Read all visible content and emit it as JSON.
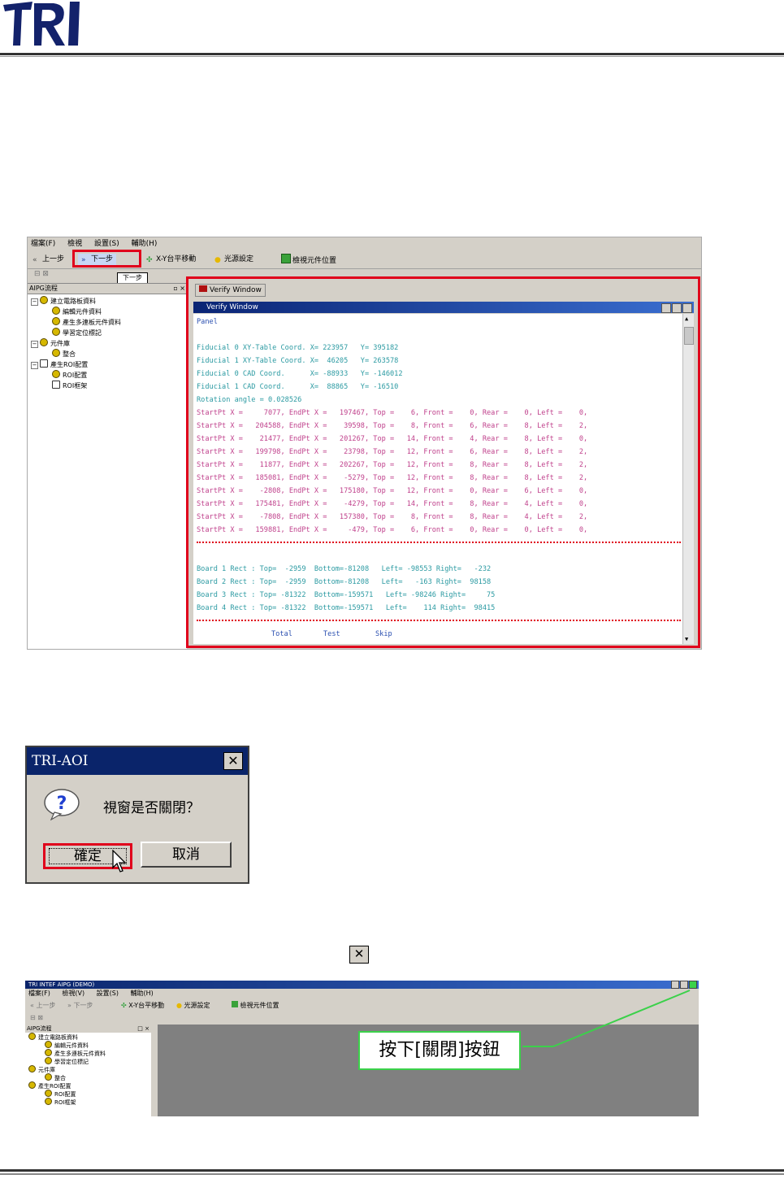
{
  "header": {
    "logo_text": "TRI"
  },
  "screenshot1": {
    "menu": [
      "檔案(F)",
      "檢視",
      "設置(S)",
      "輔助(H)"
    ],
    "toolbar": {
      "prev": "上一步",
      "next": "下一步",
      "xy_move": "X-Y台平移動",
      "light": "光源設定",
      "locate": "檢視元件位置"
    },
    "tooltip": "下一步",
    "tree": {
      "title": "AIPG流程",
      "close": "×",
      "items": [
        {
          "label": "建立電路板資料",
          "level": 0,
          "icon": "node"
        },
        {
          "label": "編輯元件資料",
          "level": 1,
          "icon": "node"
        },
        {
          "label": "產生多連板元件資料",
          "level": 1,
          "icon": "node"
        },
        {
          "label": "學習定位標記",
          "level": 1,
          "icon": "node"
        },
        {
          "label": "元件庫",
          "level": 0,
          "icon": "node"
        },
        {
          "label": "整合",
          "level": 1,
          "icon": "node"
        },
        {
          "label": "產生ROI配置",
          "level": 0,
          "icon": "empty"
        },
        {
          "label": "ROI配置",
          "level": 1,
          "icon": "node"
        },
        {
          "label": "ROI框架",
          "level": 1,
          "icon": "empty"
        }
      ]
    },
    "verify": {
      "tab": "Verify Window",
      "title": "Verify Window",
      "panel": "Panel",
      "fiducial_lines": [
        "Fiducial 0 XY-Table Coord. X= 223957   Y= 395182",
        "Fiducial 1 XY-Table Coord. X=  46205   Y= 263578",
        "Fiducial 0 CAD Coord.      X= -88933   Y= -146012",
        "Fiducial 1 CAD Coord.      X=  88865   Y= -16510",
        "Rotation angle = 0.028526"
      ],
      "start_lines": [
        "StartPt X =     7077, EndPt X =   197467, Top =    6, Front =    0, Rear =    0, Left =    0,",
        "StartPt X =   204588, EndPt X =    39598, Top =    8, Front =    6, Rear =    8, Left =    2,",
        "StartPt X =    21477, EndPt X =   201267, Top =   14, Front =    4, Rear =    8, Left =    0,",
        "StartPt X =   199798, EndPt X =    23798, Top =   12, Front =    6, Rear =    8, Left =    2,",
        "StartPt X =    11877, EndPt X =   202267, Top =   12, Front =    8, Rear =    8, Left =    2,",
        "StartPt X =   185081, EndPt X =    -5279, Top =   12, Front =    8, Rear =    8, Left =    2,",
        "StartPt X =    -2808, EndPt X =   175180, Top =   12, Front =    0, Rear =    6, Left =    0,",
        "StartPt X =   175481, EndPt X =    -4279, Top =   14, Front =    8, Rear =    4, Left =    0,",
        "StartPt X =    -7808, EndPt X =   157380, Top =    8, Front =    8, Rear =    4, Left =    2,",
        "StartPt X =   159881, EndPt X =     -479, Top =    6, Front =    0, Rear =    0, Left =    0,"
      ],
      "board_lines": [
        "Board 1 Rect : Top=  -2959  Bottom=-81208   Left= -98553 Right=   -232",
        "Board 2 Rect : Top=  -2959  Bottom=-81208   Left=   -163 Right=  98158",
        "Board 3 Rect : Top= -81322  Bottom=-159571   Left= -98246 Right=     75",
        "Board 4 Rect : Top= -81322  Bottom=-159571   Left=    114 Right=  98415"
      ],
      "totals": {
        "total": "Total",
        "test": "Test",
        "skip": "Skip"
      }
    }
  },
  "dialog": {
    "title": "TRI-AOI",
    "close": "✕",
    "message": "視窗是否關閉？",
    "ok": "確定",
    "cancel": "取消"
  },
  "close_glyph": "✕",
  "screenshot3": {
    "title": "TRI INTEF AIPG (DEMO)",
    "menu": [
      "檔案(F)",
      "檢視(V)",
      "設置(S)",
      "輔助(H)"
    ],
    "toolbar": {
      "prev": "上一步",
      "next": "下一步",
      "xy_move": "X-Y台平移動",
      "light": "光源設定",
      "locate": "檢視元件位置"
    },
    "tree": {
      "title": "AIPG流程",
      "close": "□ ×",
      "items": [
        {
          "label": "建立電路板資料",
          "level": 0
        },
        {
          "label": "編輯元件資料",
          "level": 1
        },
        {
          "label": "產生多連板元件資料",
          "level": 1
        },
        {
          "label": "學習定位標記",
          "level": 1
        },
        {
          "label": "元件庫",
          "level": 0
        },
        {
          "label": "整合",
          "level": 1
        },
        {
          "label": "產生ROI配置",
          "level": 0
        },
        {
          "label": "ROI配置",
          "level": 1
        },
        {
          "label": "ROI框架",
          "level": 1
        }
      ]
    },
    "callout": "按下[關閉]按鈕"
  },
  "colors": {
    "highlight_red": "#e0001b",
    "callout_green": "#3bd14a",
    "titlebar_blue": "#0a246a"
  }
}
